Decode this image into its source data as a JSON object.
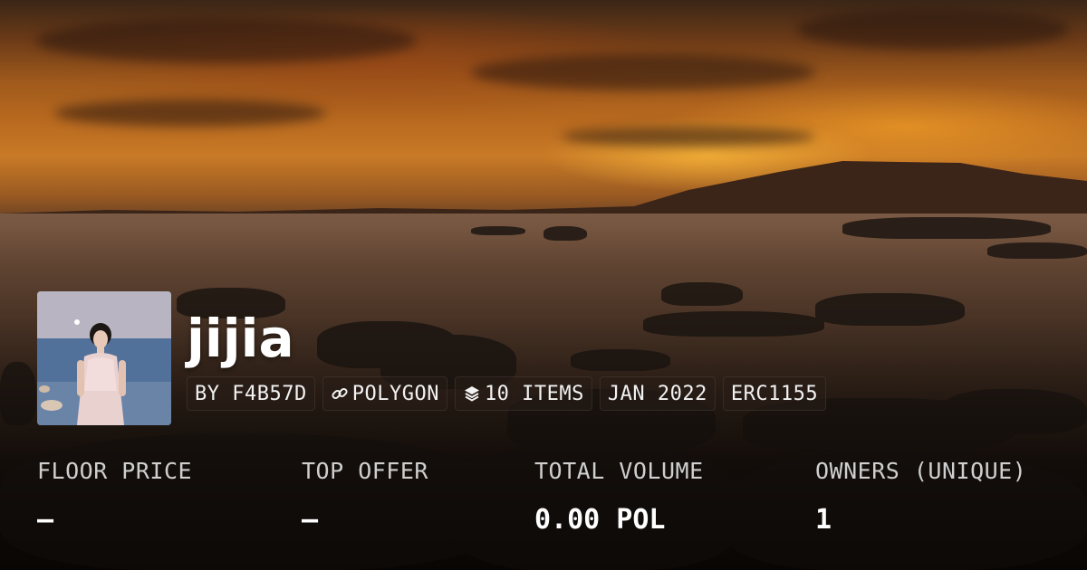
{
  "collection": {
    "name": "jijia",
    "tags": [
      {
        "icon": "",
        "text": "BY F4B57D"
      },
      {
        "icon": "link-icon",
        "text": "POLYGON"
      },
      {
        "icon": "layers-icon",
        "text": "10 ITEMS"
      },
      {
        "icon": "",
        "text": "JAN 2022"
      },
      {
        "icon": "",
        "text": "ERC1155"
      }
    ]
  },
  "stats": [
    {
      "label": "FLOOR PRICE",
      "value": "–"
    },
    {
      "label": "TOP OFFER",
      "value": "–"
    },
    {
      "label": "TOTAL VOLUME",
      "value": "0.00 POL"
    },
    {
      "label": "OWNERS (UNIQUE)",
      "value": "1"
    }
  ],
  "colors": {
    "text": "#ffffff",
    "label": "#cfcfcf",
    "tag_bg": "rgba(40,30,24,0.55)"
  }
}
